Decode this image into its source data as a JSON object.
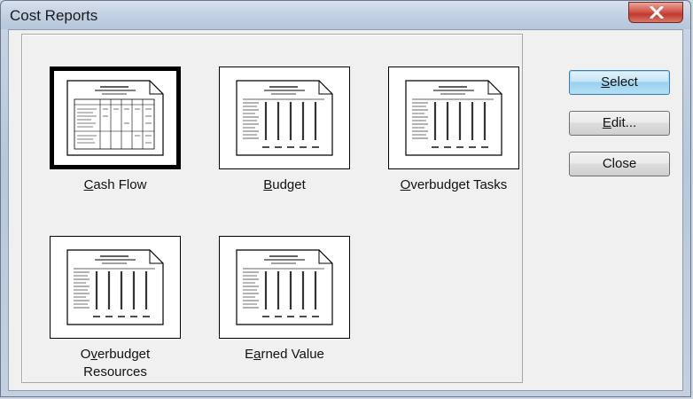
{
  "window": {
    "title": "Cost Reports"
  },
  "reports": [
    {
      "pre": "",
      "accel": "C",
      "post": "ash Flow",
      "line2": "",
      "selected": true
    },
    {
      "pre": "",
      "accel": "B",
      "post": "udget",
      "line2": "",
      "selected": false
    },
    {
      "pre": "",
      "accel": "O",
      "post": "verbudget Tasks",
      "line2": "",
      "selected": false
    },
    {
      "pre": "O",
      "accel": "v",
      "post": "erbudget",
      "line2": "Resources",
      "selected": false
    },
    {
      "pre": "E",
      "accel": "a",
      "post": "rned Value",
      "line2": "",
      "selected": false
    }
  ],
  "buttons": {
    "select": {
      "accel": "S",
      "rest": "elect"
    },
    "edit": {
      "accel": "E",
      "rest": "dit..."
    },
    "close": {
      "label": "Close"
    }
  },
  "icons": {
    "close": "close-x-icon",
    "report_thumbnail": "report-page-icon"
  }
}
